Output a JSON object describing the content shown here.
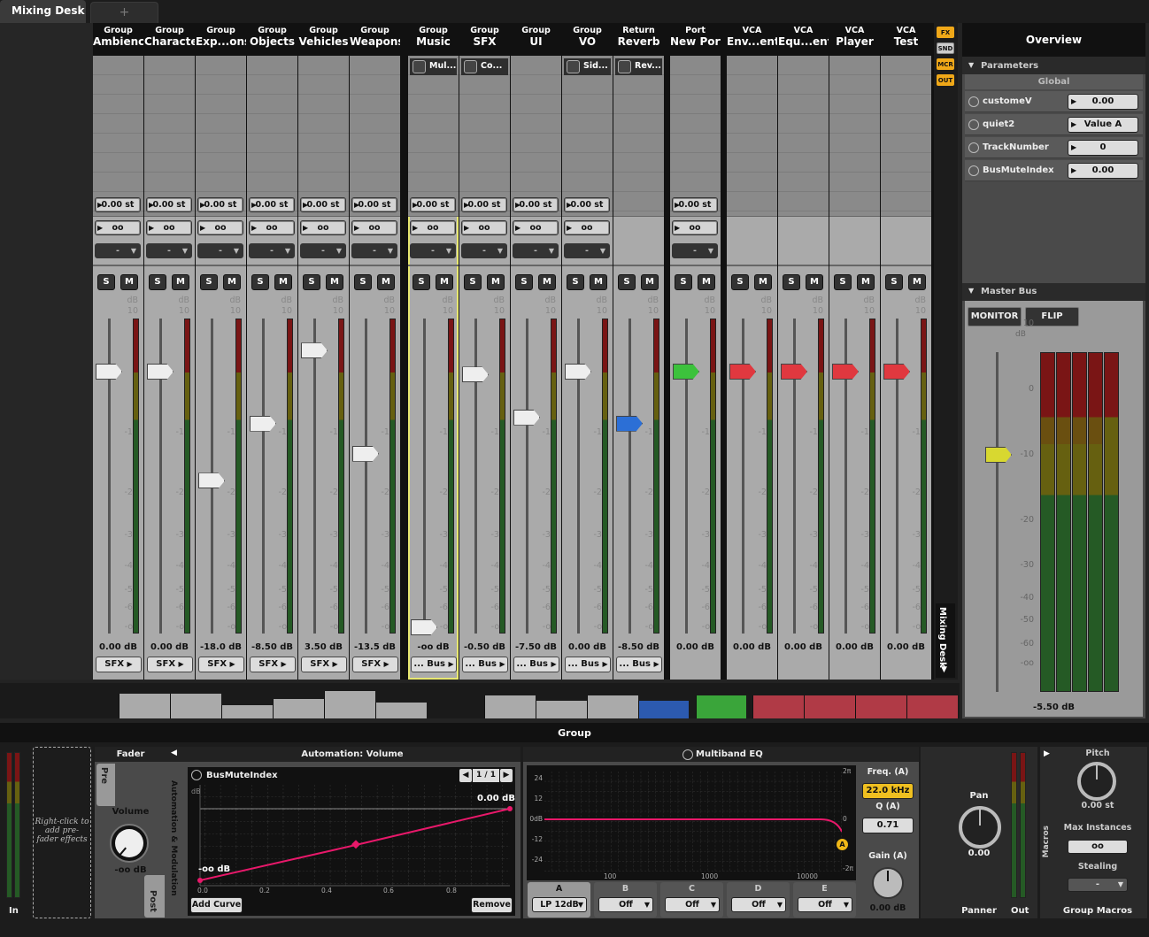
{
  "tabs": [
    {
      "label": "Mixing Desk"
    },
    {
      "label": "+"
    }
  ],
  "strips": [
    {
      "type": "Group",
      "name": "Ambience",
      "pitch": "0.00 st",
      "pan": "oo",
      "select": "-",
      "db": "0.00 dB",
      "route": "SFX",
      "fader": 0
    },
    {
      "type": "Group",
      "name": "Character",
      "pitch": "0.00 st",
      "pan": "oo",
      "select": "-",
      "db": "0.00 dB",
      "route": "SFX",
      "fader": 0
    },
    {
      "type": "Group",
      "name": "Exp...ons",
      "pitch": "0.00 st",
      "pan": "oo",
      "select": "-",
      "db": "-18.0 dB",
      "route": "SFX",
      "fader": -18
    },
    {
      "type": "Group",
      "name": "Objects",
      "pitch": "0.00 st",
      "pan": "oo",
      "select": "-",
      "db": "-8.50 dB",
      "route": "SFX",
      "fader": -8.5
    },
    {
      "type": "Group",
      "name": "Vehicles",
      "pitch": "0.00 st",
      "pan": "oo",
      "select": "-",
      "db": "3.50 dB",
      "route": "SFX",
      "fader": 3.5
    },
    {
      "type": "Group",
      "name": "Weapons",
      "pitch": "0.00 st",
      "pan": "oo",
      "select": "-",
      "db": "-13.5 dB",
      "route": "SFX",
      "fader": -13.5
    },
    {
      "type": "Group",
      "name": "Music",
      "effect": "Mul...",
      "pitch": "0.00 st",
      "pan": "oo",
      "select": "-",
      "db": "-oo dB",
      "route": "... Bus",
      "fader": -80,
      "selected": true
    },
    {
      "type": "Group",
      "name": "SFX",
      "effect": "Co...",
      "pitch": "0.00 st",
      "pan": "oo",
      "select": "-",
      "db": "-0.50 dB",
      "route": "... Bus",
      "fader": -0.5
    },
    {
      "type": "Group",
      "name": "UI",
      "pitch": "0.00 st",
      "pan": "oo",
      "select": "-",
      "db": "-7.50 dB",
      "route": "... Bus",
      "fader": -7.5
    },
    {
      "type": "Group",
      "name": "VO",
      "effect": "Sid...",
      "pitch": "0.00 st",
      "pan": "oo",
      "select": "-",
      "db": "0.00 dB",
      "route": "... Bus",
      "fader": 0
    },
    {
      "type": "Return",
      "name": "Reverb",
      "effect": "Rev...",
      "db": "-8.50 dB",
      "route": "... Bus",
      "fader": -8.5,
      "handle_color": "#2c6fd6"
    },
    {
      "type": "Port",
      "name": "New Port",
      "pitch": "0.00 st",
      "pan": "oo",
      "select": "-",
      "db": "0.00 dB",
      "fader": 0,
      "handle_color": "#3cc23c"
    },
    {
      "type": "VCA",
      "name": "Env...ent",
      "db": "0.00 dB",
      "fader": 0,
      "handle_color": "#e0383f"
    },
    {
      "type": "VCA",
      "name": "Equ...ent",
      "db": "0.00 dB",
      "fader": 0,
      "handle_color": "#e0383f"
    },
    {
      "type": "VCA",
      "name": "Player",
      "db": "0.00 dB",
      "fader": 0,
      "handle_color": "#e0383f"
    },
    {
      "type": "VCA",
      "name": "Test",
      "db": "0.00 dB",
      "fader": 0,
      "handle_color": "#e0383f"
    }
  ],
  "scale_labels": {
    "unit": "dB",
    "ticks": [
      "10",
      "0",
      "-10",
      "-20",
      "-30",
      "-40",
      "-50",
      "-60",
      "-oo"
    ]
  },
  "solo_label": "S",
  "mute_label": "M",
  "fx_side": {
    "fx": "FX",
    "snd": "SND",
    "mcr": "MCR",
    "out": "OUT",
    "vertical_label": "Mixing Desk"
  },
  "overview": {
    "title": "Overview",
    "parameters_label": "Parameters",
    "global_label": "Global",
    "params": [
      {
        "label": "customeV",
        "value": "0.00"
      },
      {
        "label": "quiet2",
        "value": "Value A"
      },
      {
        "label": "TrackNumber",
        "value": "0"
      },
      {
        "label": "BusMuteIndex",
        "value": "0.00"
      }
    ],
    "master_bus_label": "Master Bus",
    "monitor_label": "MONITOR",
    "flip_label": "FLIP",
    "master_ticks": [
      "10",
      "0",
      "-10",
      "-20",
      "-30",
      "-40",
      "-50",
      "-60",
      "-oo"
    ],
    "master_db": "-5.50 dB"
  },
  "group_panel": {
    "title": "Group",
    "in_label": "In",
    "pre_effects_hint": "Right-click to add pre-fader effects",
    "fader_label": "Fader",
    "pre_label": "Pre",
    "post_label": "Post",
    "volume_label": "Volume",
    "volume_value": "-oo dB",
    "automation_title": "Automation: Volume",
    "automation_side": "Automation & Modulation",
    "automation_param": "BusMuteIndex",
    "page": "1 / 1",
    "curve_db_label": "dB",
    "curve_top": "0.00 dB",
    "curve_bottom": "-oo dB",
    "curve_x_ticks": [
      "0.0",
      "0.2",
      "0.4",
      "0.6",
      "0.8"
    ],
    "add_curve": "Add Curve",
    "remove": "Remove",
    "eq_title": "Multiband EQ",
    "eq_y_ticks": [
      "24",
      "12",
      "0dB",
      "-12",
      "-24"
    ],
    "eq_x_ticks": [
      "100",
      "1000",
      "10000"
    ],
    "eq_right": [
      "2π",
      "0",
      "-2π"
    ],
    "eq_band_marker": "A",
    "freq_label": "Freq. (A)",
    "freq_value": "22.0 kHz",
    "q_label": "Q (A)",
    "q_value": "0.71",
    "gain_label": "Gain (A)",
    "gain_value": "0.00 dB",
    "bands": [
      {
        "label": "A",
        "mode": "LP 12dB"
      },
      {
        "label": "B",
        "mode": "Off"
      },
      {
        "label": "C",
        "mode": "Off"
      },
      {
        "label": "D",
        "mode": "Off"
      },
      {
        "label": "E",
        "mode": "Off"
      }
    ],
    "pan_label": "Pan",
    "pan_value": "0.00",
    "panner_label": "Panner",
    "out_label": "Out",
    "macros_side": "Macros",
    "pitch_label": "Pitch",
    "pitch_value": "0.00 st",
    "max_instances_label": "Max Instances",
    "max_instances_value": "oo",
    "stealing_label": "Stealing",
    "stealing_value": "-",
    "group_macros_label": "Group Macros"
  }
}
